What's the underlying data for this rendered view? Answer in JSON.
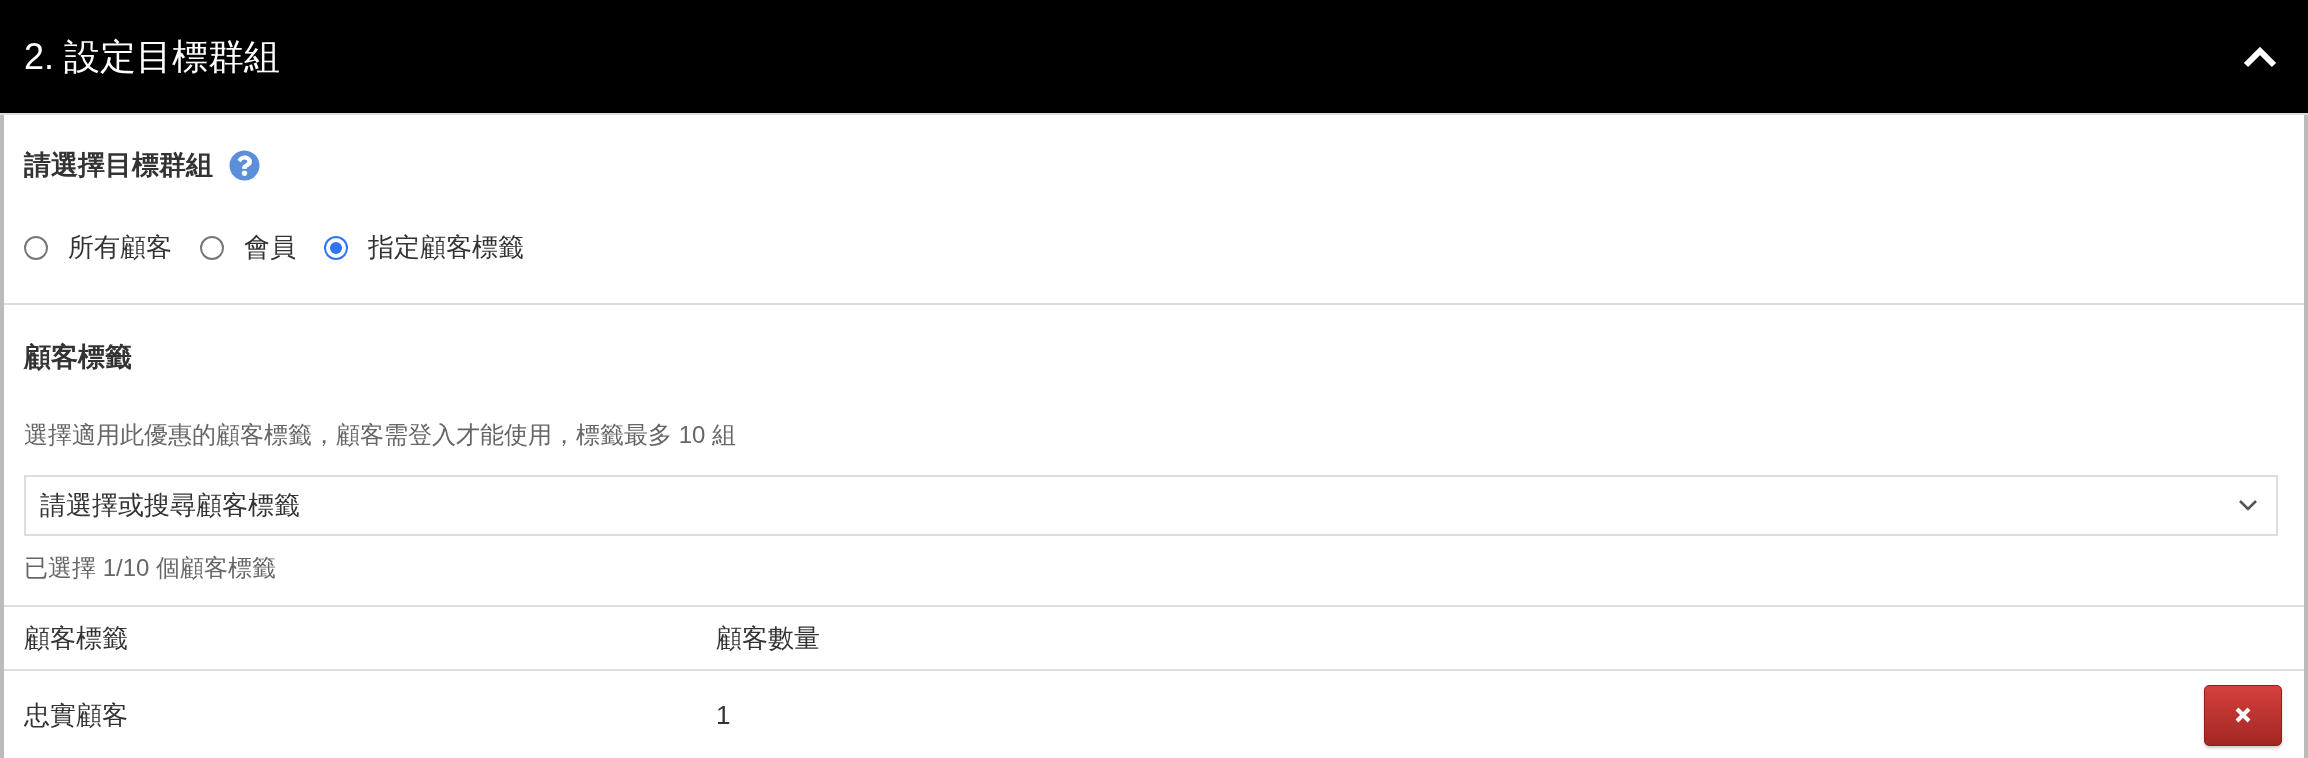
{
  "panel": {
    "title": "2. 設定目標群組",
    "expanded": true
  },
  "target_group": {
    "label": "請選擇目標群組",
    "options": [
      {
        "label": "所有顧客",
        "selected": false
      },
      {
        "label": "會員",
        "selected": false
      },
      {
        "label": "指定顧客標籤",
        "selected": true
      }
    ]
  },
  "customer_tags": {
    "label": "顧客標籤",
    "description": "選擇適用此優惠的顧客標籤，顧客需登入才能使用，標籤最多 10 組",
    "select": {
      "placeholder": "請選擇或搜尋顧客標籤"
    },
    "selected_count": "已選擇 1/10 個顧客標籤"
  },
  "table": {
    "columns": [
      "顧客標籤",
      "顧客數量"
    ],
    "rows": [
      {
        "cells": [
          "忠實顧客",
          "1"
        ]
      }
    ]
  }
}
